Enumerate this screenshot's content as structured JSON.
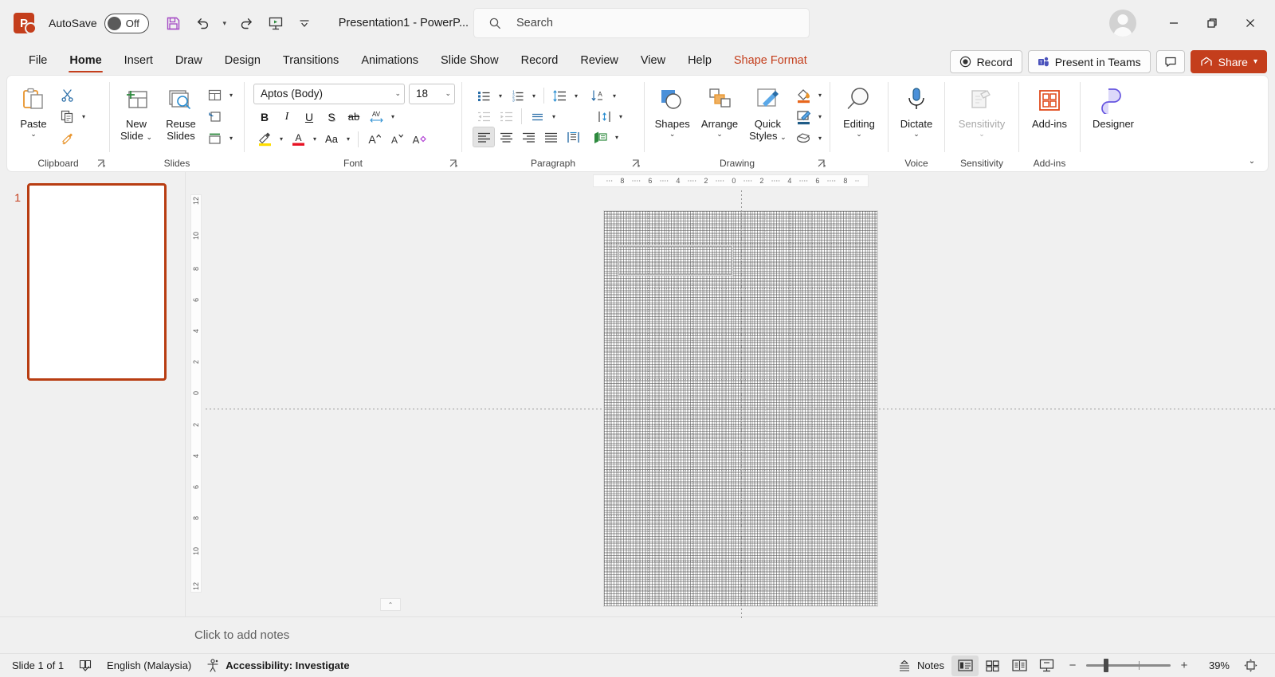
{
  "titlebar": {
    "app_logo": "powerpoint-logo",
    "autosave_label": "AutoSave",
    "autosave_state": "Off",
    "document_title": "Presentation1  -  PowerP...",
    "quick_access": [
      {
        "name": "save-button",
        "icon": "save-icon"
      },
      {
        "name": "undo-button",
        "icon": "undo-icon"
      },
      {
        "name": "redo-button",
        "icon": "redo-icon"
      },
      {
        "name": "start-presentation-button",
        "icon": "presentation-icon"
      },
      {
        "name": "customize-quick-access-button",
        "icon": "chevron-down-icon"
      }
    ],
    "window_controls": {
      "minimize": "minimize-icon",
      "restore": "restore-icon",
      "close": "close-icon"
    }
  },
  "search": {
    "placeholder": "Search",
    "icon": "search-icon"
  },
  "tabs": [
    {
      "label": "File",
      "active": false,
      "contextual": false
    },
    {
      "label": "Home",
      "active": true,
      "contextual": false
    },
    {
      "label": "Insert",
      "active": false,
      "contextual": false
    },
    {
      "label": "Draw",
      "active": false,
      "contextual": false
    },
    {
      "label": "Design",
      "active": false,
      "contextual": false
    },
    {
      "label": "Transitions",
      "active": false,
      "contextual": false
    },
    {
      "label": "Animations",
      "active": false,
      "contextual": false
    },
    {
      "label": "Slide Show",
      "active": false,
      "contextual": false
    },
    {
      "label": "Record",
      "active": false,
      "contextual": false
    },
    {
      "label": "Review",
      "active": false,
      "contextual": false
    },
    {
      "label": "View",
      "active": false,
      "contextual": false
    },
    {
      "label": "Help",
      "active": false,
      "contextual": false
    },
    {
      "label": "Shape Format",
      "active": false,
      "contextual": true
    }
  ],
  "tab_right_buttons": {
    "record_label": "Record",
    "present_in_teams_label": "Present in Teams",
    "comments_label": "",
    "share_label": "Share"
  },
  "ribbon": {
    "groups": [
      {
        "name": "clipboard",
        "label": "Clipboard",
        "items": [
          {
            "name": "paste-button",
            "label": "Paste",
            "caret": "⌄"
          },
          {
            "name": "cut-button",
            "label": ""
          },
          {
            "name": "copy-button",
            "label": ""
          },
          {
            "name": "format-painter-button",
            "label": ""
          }
        ]
      },
      {
        "name": "slides",
        "label": "Slides",
        "items": [
          {
            "name": "new-slide-button",
            "label": "New\nSlide"
          },
          {
            "name": "reuse-slides-button",
            "label": "Reuse\nSlides"
          },
          {
            "name": "slide-layout-button",
            "label": ""
          },
          {
            "name": "reset-slide-button",
            "label": ""
          },
          {
            "name": "section-button",
            "label": ""
          }
        ]
      },
      {
        "name": "font",
        "label": "Font",
        "font_name": "Aptos (Body)",
        "font_size": "18",
        "items": [
          {
            "name": "bold-button",
            "label": "B"
          },
          {
            "name": "italic-button",
            "label": "I"
          },
          {
            "name": "underline-button",
            "label": "U"
          },
          {
            "name": "shadow-button",
            "label": "S"
          },
          {
            "name": "strikethrough-button",
            "label": "ab"
          },
          {
            "name": "character-spacing-button",
            "label": "AV"
          },
          {
            "name": "text-highlight-color-button",
            "label": ""
          },
          {
            "name": "font-color-button",
            "label": "A"
          },
          {
            "name": "change-case-button",
            "label": "Aa"
          },
          {
            "name": "increase-font-size-button",
            "label": "A"
          },
          {
            "name": "decrease-font-size-button",
            "label": "A"
          },
          {
            "name": "clear-formatting-button",
            "label": "A"
          }
        ]
      },
      {
        "name": "paragraph",
        "label": "Paragraph",
        "items": [
          {
            "name": "bullets-button",
            "label": ""
          },
          {
            "name": "numbering-button",
            "label": ""
          },
          {
            "name": "line-spacing-button",
            "label": ""
          },
          {
            "name": "text-direction-button",
            "label": ""
          },
          {
            "name": "decrease-indent-button",
            "label": ""
          },
          {
            "name": "increase-indent-button",
            "label": ""
          },
          {
            "name": "paragraph-spacing-button",
            "label": ""
          },
          {
            "name": "align-text-button",
            "label": ""
          },
          {
            "name": "align-left-button",
            "label": ""
          },
          {
            "name": "center-button",
            "label": ""
          },
          {
            "name": "align-right-button",
            "label": ""
          },
          {
            "name": "justify-button",
            "label": ""
          },
          {
            "name": "columns-button",
            "label": ""
          },
          {
            "name": "convert-to-smartart-button",
            "label": ""
          }
        ]
      },
      {
        "name": "drawing",
        "label": "Drawing",
        "items": [
          {
            "name": "shapes-button",
            "label": "Shapes"
          },
          {
            "name": "arrange-button",
            "label": "Arrange"
          },
          {
            "name": "quick-styles-button",
            "label": "Quick\nStyles"
          },
          {
            "name": "shape-fill-button",
            "label": ""
          },
          {
            "name": "shape-outline-button",
            "label": ""
          },
          {
            "name": "shape-effects-button",
            "label": ""
          }
        ]
      },
      {
        "name": "editing",
        "label": "",
        "items": [
          {
            "name": "editing-button",
            "label": "Editing"
          }
        ]
      },
      {
        "name": "voice",
        "label": "Voice",
        "items": [
          {
            "name": "dictate-button",
            "label": "Dictate"
          }
        ]
      },
      {
        "name": "sensitivity",
        "label": "Sensitivity",
        "items": [
          {
            "name": "sensitivity-button",
            "label": "Sensitivity",
            "disabled": true
          }
        ]
      },
      {
        "name": "add-ins",
        "label": "Add-ins",
        "items": [
          {
            "name": "add-ins-button",
            "label": "Add-ins"
          }
        ]
      },
      {
        "name": "designer",
        "label": "",
        "items": [
          {
            "name": "designer-button",
            "label": "Designer"
          }
        ]
      }
    ],
    "collapse_icon": "chevron-down-icon"
  },
  "thumbnails": {
    "slides": [
      {
        "number": "1",
        "selected": true
      }
    ]
  },
  "rulers": {
    "horizontal_ticks": [
      "8",
      "6",
      "4",
      "2",
      "0",
      "2",
      "4",
      "6",
      "8"
    ],
    "vertical_ticks": [
      "12",
      "10",
      "8",
      "6",
      "4",
      "2",
      "0",
      "2",
      "4",
      "6",
      "8",
      "10",
      "12"
    ]
  },
  "slide_canvas": {
    "shape": {
      "name": "text-box-shape",
      "selected": true
    },
    "grid_visible": true,
    "guides_visible": true
  },
  "notes": {
    "placeholder": "Click to add notes",
    "resize_handle": "notes-resize-handle"
  },
  "status_bar": {
    "slide_indicator": "Slide 1 of 1",
    "spell_check_icon": "spell-check-icon",
    "language": "English (Malaysia)",
    "accessibility_icon": "accessibility-icon",
    "accessibility": "Accessibility: Investigate",
    "notes_label": "Notes",
    "notes_icon": "notes-icon",
    "views": [
      {
        "name": "normal-view-button",
        "icon": "normal-view-icon",
        "active": true
      },
      {
        "name": "slide-sorter-view-button",
        "icon": "slide-sorter-icon",
        "active": false
      },
      {
        "name": "reading-view-button",
        "icon": "reading-view-icon",
        "active": false
      },
      {
        "name": "slide-show-button",
        "icon": "slide-show-icon",
        "active": false
      }
    ],
    "zoom": {
      "minus": "−",
      "plus": "+",
      "level": "39%",
      "fit_icon": "fit-to-window-icon"
    }
  },
  "colors": {
    "accent": "#c43e1c",
    "ribbon_bg": "#ffffff",
    "chrome_bg": "#f0f0f0",
    "thumb_border": "#b83d12",
    "contextual_tab": "#c43e1c"
  }
}
